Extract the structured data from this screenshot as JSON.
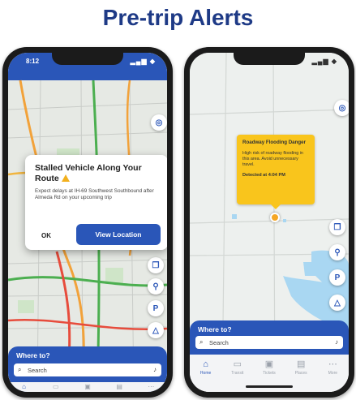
{
  "headline": "Pre-trip Alerts",
  "left_phone": {
    "status_time": "8:12",
    "status_icons": "▂▄▆ ◆",
    "dialog": {
      "title": "Stalled Vehicle Along Your Route",
      "body": "Expect delays at IH-69 Southwest Southbound after Almeda Rd on your upcoming trip",
      "ok_label": "OK",
      "view_label": "View Location"
    },
    "where_to": "Where to?",
    "search_placeholder": "Search"
  },
  "right_phone": {
    "status_icons": "▂▄▆ ◆",
    "alert": {
      "title": "Roadway Flooding Danger",
      "body": "High risk of roadway flooding in this area. Avoid unnecessary travel.",
      "time": "Detected at 4:04 PM"
    },
    "where_to": "Where to?",
    "search_placeholder": "Search",
    "tabs": [
      {
        "label": "Home",
        "icon": "home-icon"
      },
      {
        "label": "Transit",
        "icon": "bus-icon"
      },
      {
        "label": "Tickets",
        "icon": "ticket-icon"
      },
      {
        "label": "Places",
        "icon": "places-icon"
      },
      {
        "label": "More",
        "icon": "more-icon"
      }
    ]
  },
  "colors": {
    "headline": "#1e3a86",
    "primary": "#2a56b8",
    "alert_yellow": "#f9c51c",
    "warning_amber": "#f2b01e"
  }
}
